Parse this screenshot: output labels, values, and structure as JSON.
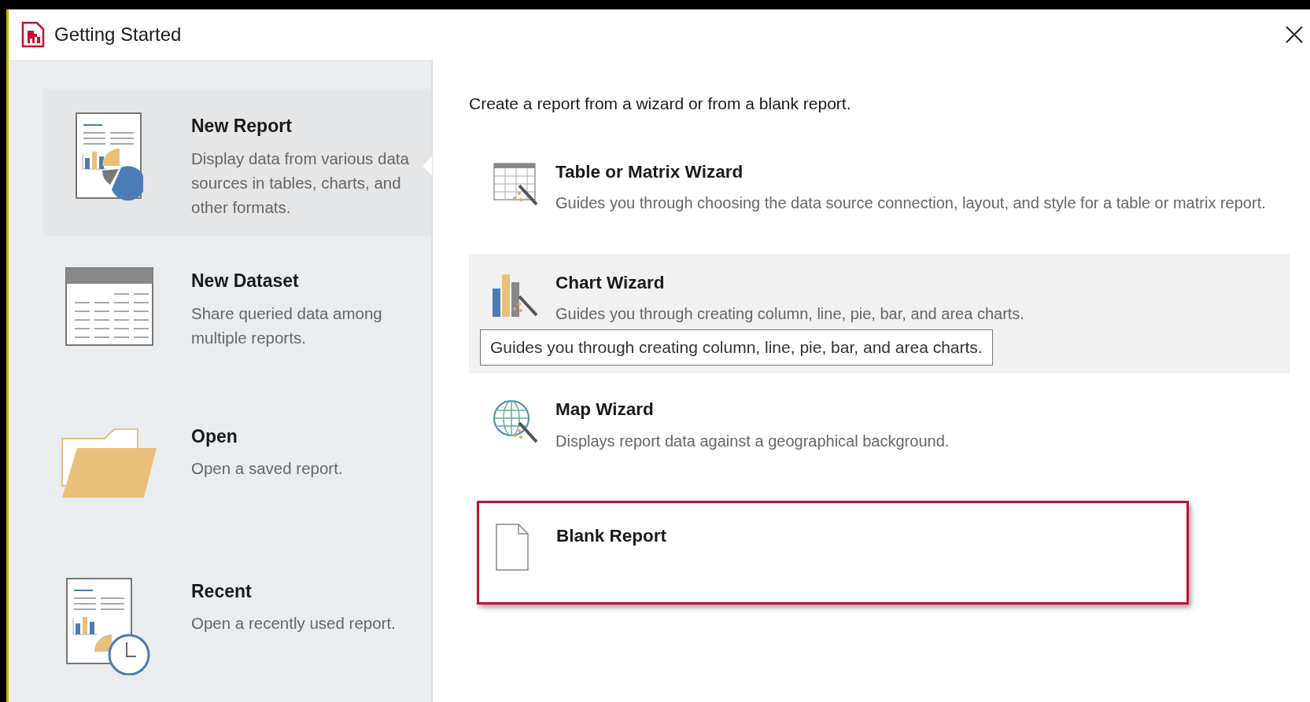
{
  "window": {
    "title": "Getting Started"
  },
  "sidebar": {
    "items": [
      {
        "kind": "new-report",
        "title": "New Report",
        "description": "Display data from various data sources in tables, charts, and other formats.",
        "selected": true
      },
      {
        "kind": "new-dataset",
        "title": "New Dataset",
        "description": "Share queried data among multiple reports.",
        "selected": false
      },
      {
        "kind": "open",
        "title": "Open",
        "description": "Open a saved report.",
        "selected": false
      },
      {
        "kind": "recent",
        "title": "Recent",
        "description": "Open a recently used report.",
        "selected": false
      }
    ]
  },
  "content": {
    "intro": "Create a report from a wizard or from a blank report.",
    "options": [
      {
        "kind": "table",
        "title": "Table or Matrix Wizard",
        "description": "Guides you through choosing the data source connection, layout, and style for a table or matrix report.",
        "hovered": false,
        "highlighted": false
      },
      {
        "kind": "chart",
        "title": "Chart Wizard",
        "description": "Guides you through creating column, line, pie, bar, and area charts.",
        "hovered": true,
        "highlighted": false,
        "tooltip": "Guides you through creating column, line, pie, bar, and area charts."
      },
      {
        "kind": "map",
        "title": "Map Wizard",
        "description": "Displays report data against a geographical background.",
        "hovered": false,
        "highlighted": false
      },
      {
        "kind": "blank",
        "title": "Blank Report",
        "hovered": false,
        "highlighted": true
      }
    ]
  }
}
